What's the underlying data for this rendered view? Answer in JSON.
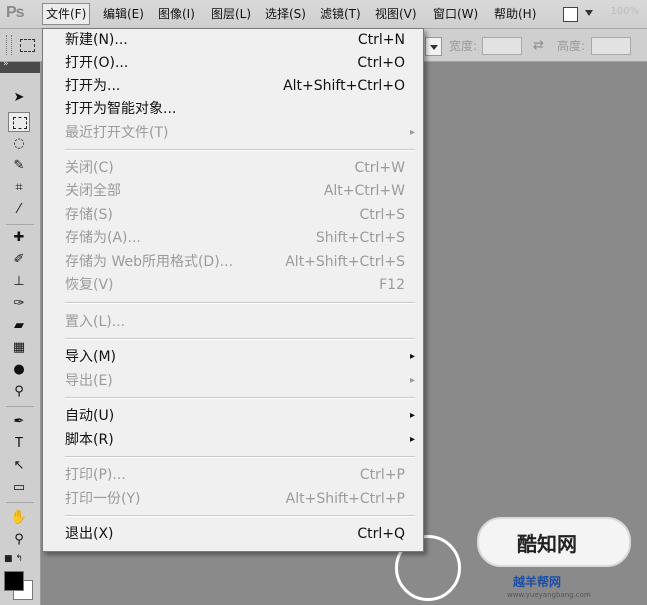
{
  "menubar": {
    "logo": "Ps",
    "items": [
      "文件(F)",
      "编辑(E)",
      "图像(I)",
      "图层(L)",
      "选择(S)",
      "滤镜(T)",
      "视图(V)",
      "窗口(W)",
      "帮助(H)"
    ],
    "zoom": "100%"
  },
  "options": {
    "width_label": "宽度:",
    "height_label": "高度:"
  },
  "file_menu": {
    "items": [
      {
        "label": "新建(N)...",
        "shortcut": "Ctrl+N",
        "enabled": true
      },
      {
        "label": "打开(O)...",
        "shortcut": "Ctrl+O",
        "enabled": true
      },
      {
        "label": "打开为...",
        "shortcut": "Alt+Shift+Ctrl+O",
        "enabled": true
      },
      {
        "label": "打开为智能对象...",
        "shortcut": "",
        "enabled": true
      },
      {
        "label": "最近打开文件(T)",
        "shortcut": "",
        "enabled": false,
        "submenu": true
      },
      {
        "label": "关闭(C)",
        "shortcut": "Ctrl+W",
        "enabled": false
      },
      {
        "label": "关闭全部",
        "shortcut": "Alt+Ctrl+W",
        "enabled": false
      },
      {
        "label": "存储(S)",
        "shortcut": "Ctrl+S",
        "enabled": false
      },
      {
        "label": "存储为(A)...",
        "shortcut": "Shift+Ctrl+S",
        "enabled": false
      },
      {
        "label": "存储为 Web所用格式(D)...",
        "shortcut": "Alt+Shift+Ctrl+S",
        "enabled": false
      },
      {
        "label": "恢复(V)",
        "shortcut": "F12",
        "enabled": false
      },
      {
        "label": "置入(L)...",
        "shortcut": "",
        "enabled": false
      },
      {
        "label": "导入(M)",
        "shortcut": "",
        "enabled": true,
        "submenu": true
      },
      {
        "label": "导出(E)",
        "shortcut": "",
        "enabled": false,
        "submenu": true
      },
      {
        "label": "自动(U)",
        "shortcut": "",
        "enabled": true,
        "submenu": true
      },
      {
        "label": "脚本(R)",
        "shortcut": "",
        "enabled": true,
        "submenu": true
      },
      {
        "label": "打印(P)...",
        "shortcut": "Ctrl+P",
        "enabled": false
      },
      {
        "label": "打印一份(Y)",
        "shortcut": "Alt+Shift+Ctrl+P",
        "enabled": false
      },
      {
        "label": "退出(X)",
        "shortcut": "Ctrl+Q",
        "enabled": true
      }
    ]
  },
  "watermark": {
    "badge_text": "酷知网",
    "site_name": "越羊帮网",
    "site_url": "www.yueyangbang.com"
  }
}
